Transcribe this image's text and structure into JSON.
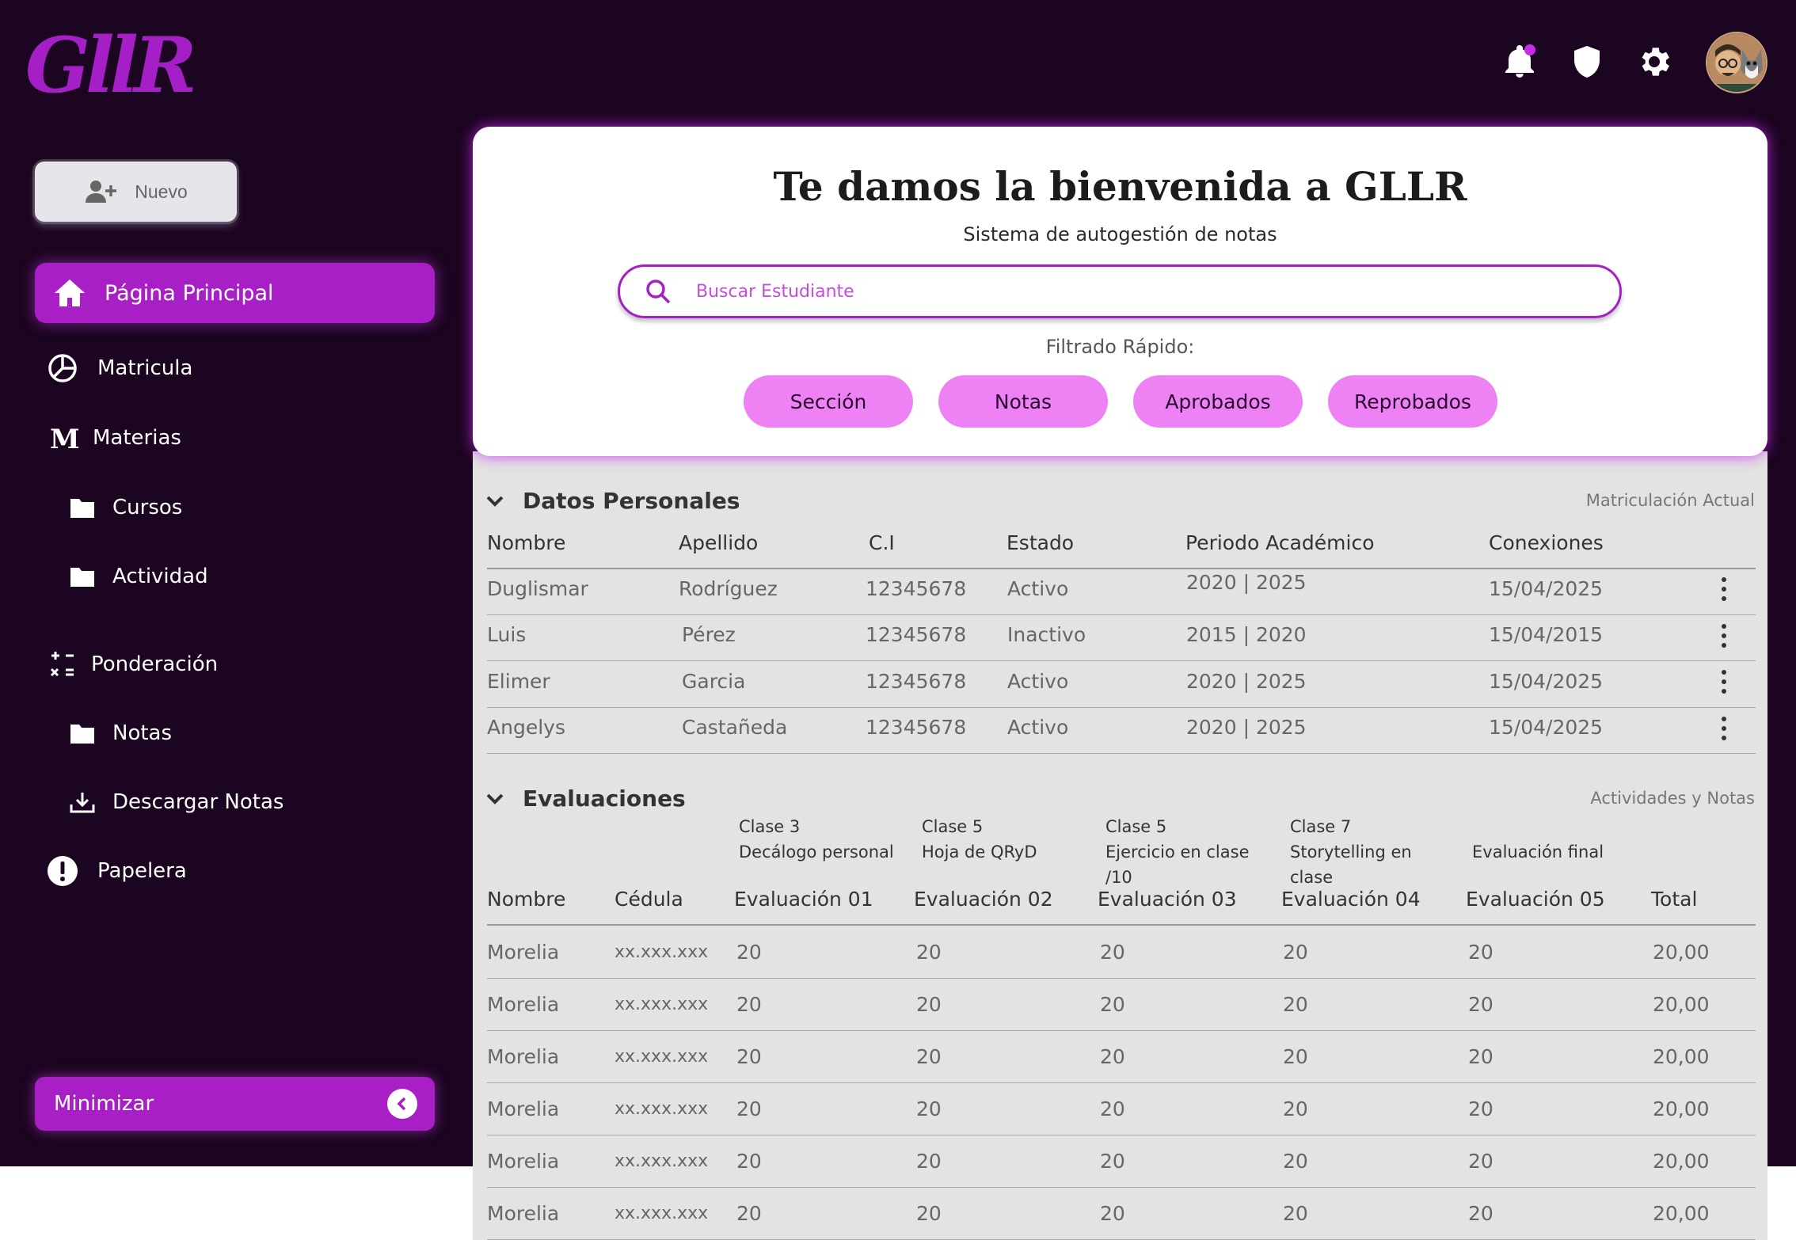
{
  "brand": {
    "logo_text": "GllR",
    "accent": "#a81fc5",
    "bg_dark": "#1b0520"
  },
  "topbar": {
    "icons": [
      "bell-icon",
      "shield-icon",
      "gear-icon",
      "avatar"
    ]
  },
  "sidebar": {
    "new_button": "Nuevo",
    "items": [
      {
        "label": "Página Principal",
        "icon": "home-icon"
      },
      {
        "label": "Matricula",
        "icon": "pie-chart-icon"
      },
      {
        "label": "Materias",
        "icon": "m-letter-icon"
      },
      {
        "label": "Cursos",
        "icon": "folder-icon"
      },
      {
        "label": "Actividad",
        "icon": "folder-icon"
      },
      {
        "label": "Ponderación",
        "icon": "calculator-icon"
      },
      {
        "label": "Notas",
        "icon": "folder-icon"
      },
      {
        "label": "Descargar Notas",
        "icon": "download-icon"
      },
      {
        "label": "Papelera",
        "icon": "alert-icon"
      }
    ],
    "minimize": "Minimizar"
  },
  "welcome": {
    "title": "Te damos la bienvenida a GLLR",
    "subtitle": "Sistema de autogestión de notas",
    "search_placeholder": "Buscar Estudiante",
    "filter_label": "Filtrado Rápido:",
    "filters": [
      "Sección",
      "Notas",
      "Aprobados",
      "Reprobados"
    ]
  },
  "personal": {
    "title": "Datos Personales",
    "right_label": "Matriculación Actual",
    "columns": [
      "Nombre",
      "Apellido",
      "C.I",
      "Estado",
      "Periodo Académico",
      "Conexiones"
    ],
    "rows": [
      [
        "Duglismar",
        "Rodríguez",
        "12345678",
        "Activo",
        "2020 | 2025",
        "15/04/2025"
      ],
      [
        "Luis",
        "Pérez",
        "12345678",
        "Inactivo",
        "2015 | 2020",
        "15/04/2015"
      ],
      [
        "Elimer",
        "Garcia",
        "12345678",
        "Activo",
        "2020 | 2025",
        "15/04/2025"
      ],
      [
        "Angelys",
        "Castañeda",
        "12345678",
        "Activo",
        "2020 | 2025",
        "15/04/2025"
      ]
    ]
  },
  "evaluations": {
    "title": "Evaluaciones",
    "right_label": "Actividades y Notas",
    "clases": [
      [
        "Clase 3",
        "Decálogo personal"
      ],
      [
        "Clase 5",
        "Hoja de QRyD"
      ],
      [
        "Clase 5",
        "Ejercicio en clase",
        "/10"
      ],
      [
        "Clase 7",
        "Storytelling en",
        "clase"
      ],
      [
        "",
        "Evaluación final"
      ]
    ],
    "columns": [
      "Nombre",
      "Cédula",
      "Evaluación 01",
      "Evaluación 02",
      "Evaluación 03",
      "Evaluación 04",
      "Evaluación 05",
      "Total"
    ],
    "rows": [
      [
        "Morelia",
        "xx.xxx.xxx",
        "20",
        "20",
        "20",
        "20",
        "20",
        "20,00"
      ],
      [
        "Morelia",
        "xx.xxx.xxx",
        "20",
        "20",
        "20",
        "20",
        "20",
        "20,00"
      ],
      [
        "Morelia",
        "xx.xxx.xxx",
        "20",
        "20",
        "20",
        "20",
        "20",
        "20,00"
      ],
      [
        "Morelia",
        "xx.xxx.xxx",
        "20",
        "20",
        "20",
        "20",
        "20",
        "20,00"
      ],
      [
        "Morelia",
        "xx.xxx.xxx",
        "20",
        "20",
        "20",
        "20",
        "20",
        "20,00"
      ],
      [
        "Morelia",
        "xx.xxx.xxx",
        "20",
        "20",
        "20",
        "20",
        "20",
        "20,00"
      ]
    ]
  }
}
